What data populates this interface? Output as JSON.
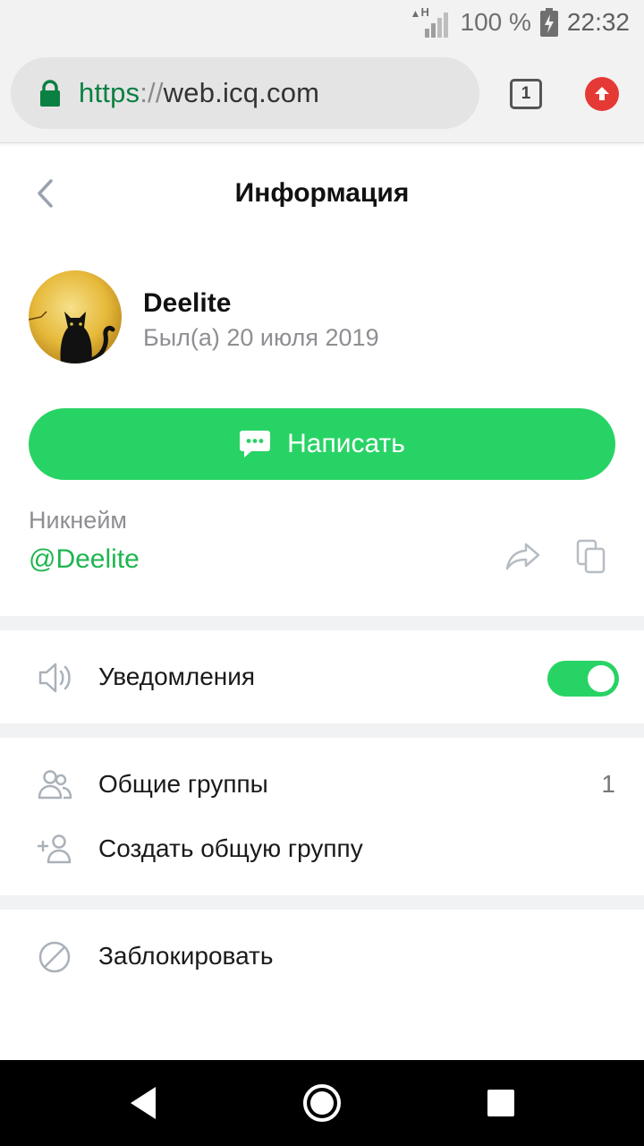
{
  "status_bar": {
    "network_type": "H",
    "battery_percent": "100 %",
    "time": "22:32"
  },
  "browser": {
    "url_scheme": "https",
    "url_separator": "://",
    "url_host": "web.icq.com",
    "tab_count": "1"
  },
  "header": {
    "title": "Информация"
  },
  "profile": {
    "name": "Deelite",
    "last_seen": "Был(а) 20 июля 2019",
    "write_button_label": "Написать"
  },
  "nickname": {
    "label": "Никнейм",
    "value": "@Deelite"
  },
  "settings": {
    "notifications_label": "Уведомления",
    "notifications_enabled": true
  },
  "groups": {
    "common_groups_label": "Общие группы",
    "common_groups_count": "1",
    "create_group_label": "Создать общую группу"
  },
  "actions": {
    "block_label": "Заблокировать"
  },
  "colors": {
    "accent_green": "#28d365",
    "link_green": "#1fb54f",
    "url_green": "#0b8043",
    "update_red": "#e53935"
  },
  "icons": [
    "lock-icon",
    "tabs-icon",
    "update-icon",
    "back-icon",
    "chat-icon",
    "share-icon",
    "copy-icon",
    "speaker-icon",
    "group-icon",
    "add-user-icon",
    "block-icon",
    "nav-back-icon",
    "nav-home-icon",
    "nav-recents-icon"
  ]
}
